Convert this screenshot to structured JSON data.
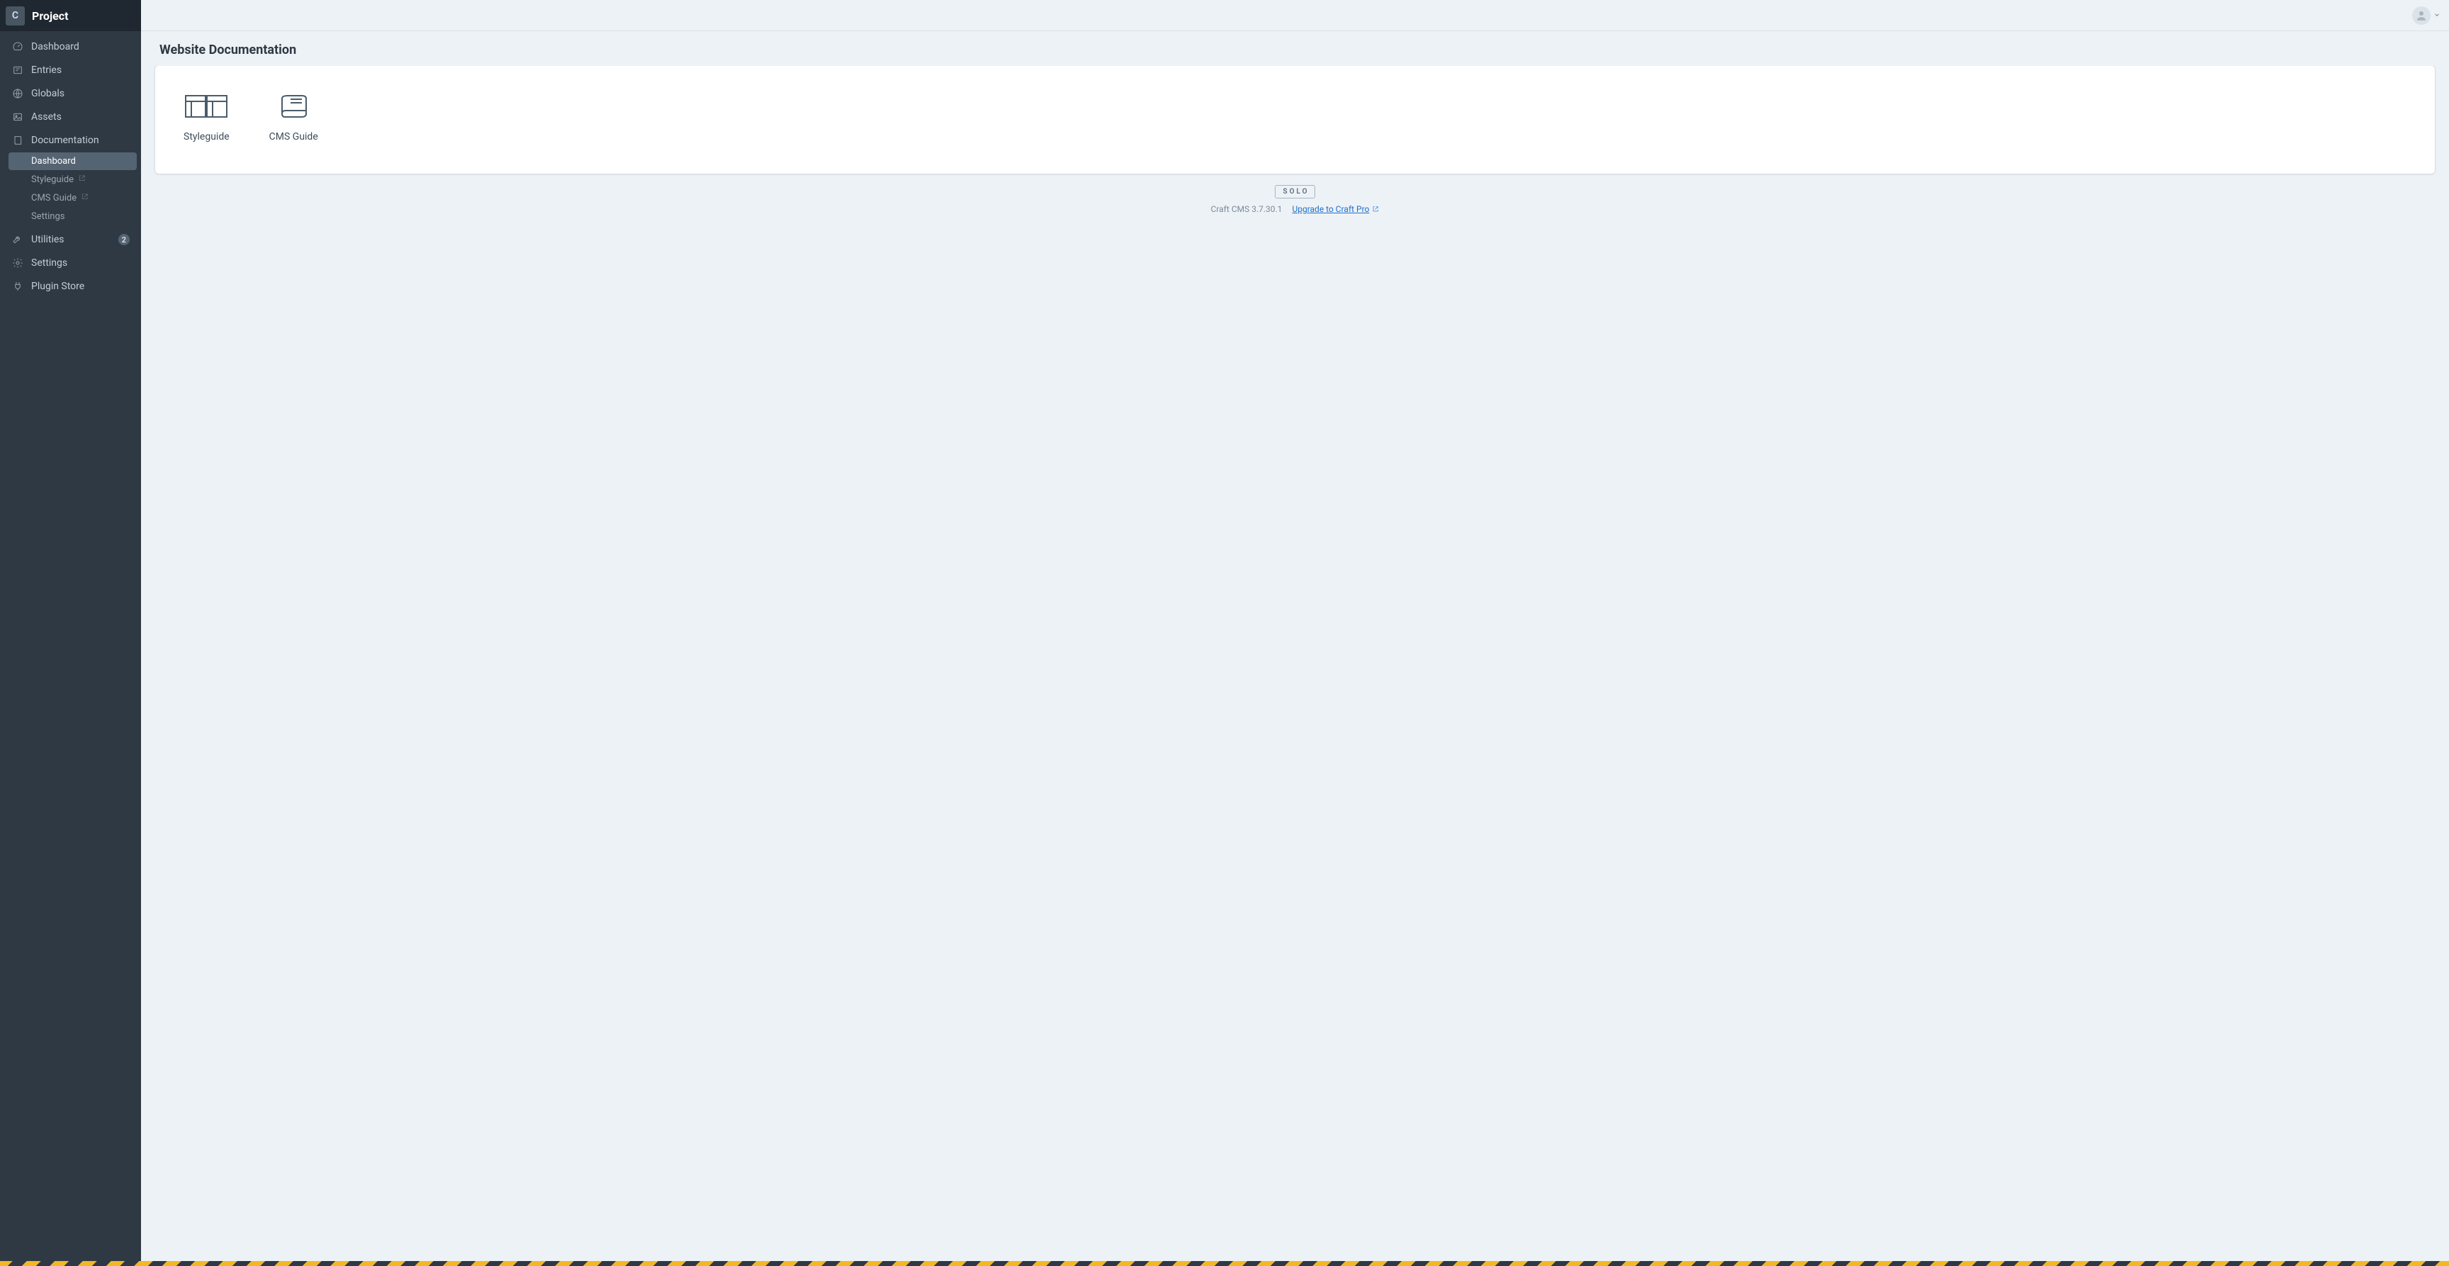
{
  "header": {
    "logo_letter": "C",
    "project_title": "Project"
  },
  "nav": {
    "dashboard": "Dashboard",
    "entries": "Entries",
    "globals": "Globals",
    "assets": "Assets",
    "documentation": "Documentation",
    "utilities": "Utilities",
    "utilities_badge": "2",
    "settings": "Settings",
    "plugin_store": "Plugin Store"
  },
  "nav_sub": {
    "dashboard": "Dashboard",
    "styleguide": "Styleguide",
    "cms_guide": "CMS Guide",
    "settings": "Settings"
  },
  "page": {
    "title": "Website Documentation"
  },
  "cards": {
    "styleguide": "Styleguide",
    "cms_guide": "CMS Guide"
  },
  "footer": {
    "edition": "SOLO",
    "version": "Craft CMS 3.7.30.1",
    "upgrade": "Upgrade to Craft Pro"
  }
}
